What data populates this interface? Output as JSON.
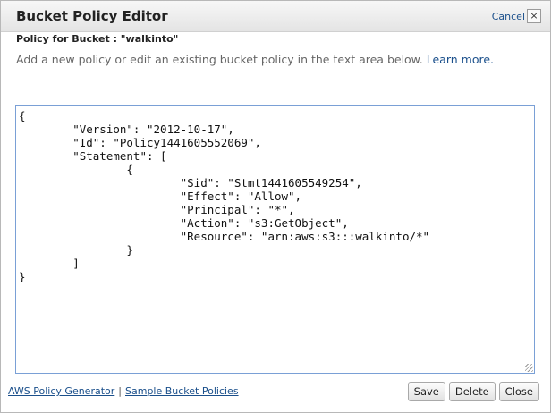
{
  "dialog": {
    "title": "Bucket Policy Editor",
    "cancel_label": "Cancel",
    "close_glyph": "×",
    "subtitle": "Policy for Bucket : \"walkinto\"",
    "description_text": "Add a new policy or edit an existing bucket policy in the text area below.",
    "learn_more_label": "Learn more."
  },
  "editor": {
    "lines": [
      "{",
      "        \"Version\": \"2012-10-17\",",
      "        \"Id\": \"Policy1441605552069\",",
      "        \"Statement\": [",
      "                {",
      "                        \"Sid\": \"Stmt1441605549254\",",
      "                        \"Effect\": \"Allow\",",
      "                        \"Principal\": \"*\",",
      "                        \"Action\": \"s3:GetObject\",",
      "                        \"Resource\": \"arn:aws:s3:::walkinto/*\"",
      "                }",
      "        ]",
      "}"
    ]
  },
  "footer": {
    "policy_generator_label": "AWS Policy Generator",
    "separator": "|",
    "sample_policies_label": "Sample Bucket Policies",
    "save_label": "Save",
    "delete_label": "Delete",
    "close_label": "Close"
  },
  "colors": {
    "link": "#1a4f8b",
    "editor_border": "#7aa0d6"
  }
}
